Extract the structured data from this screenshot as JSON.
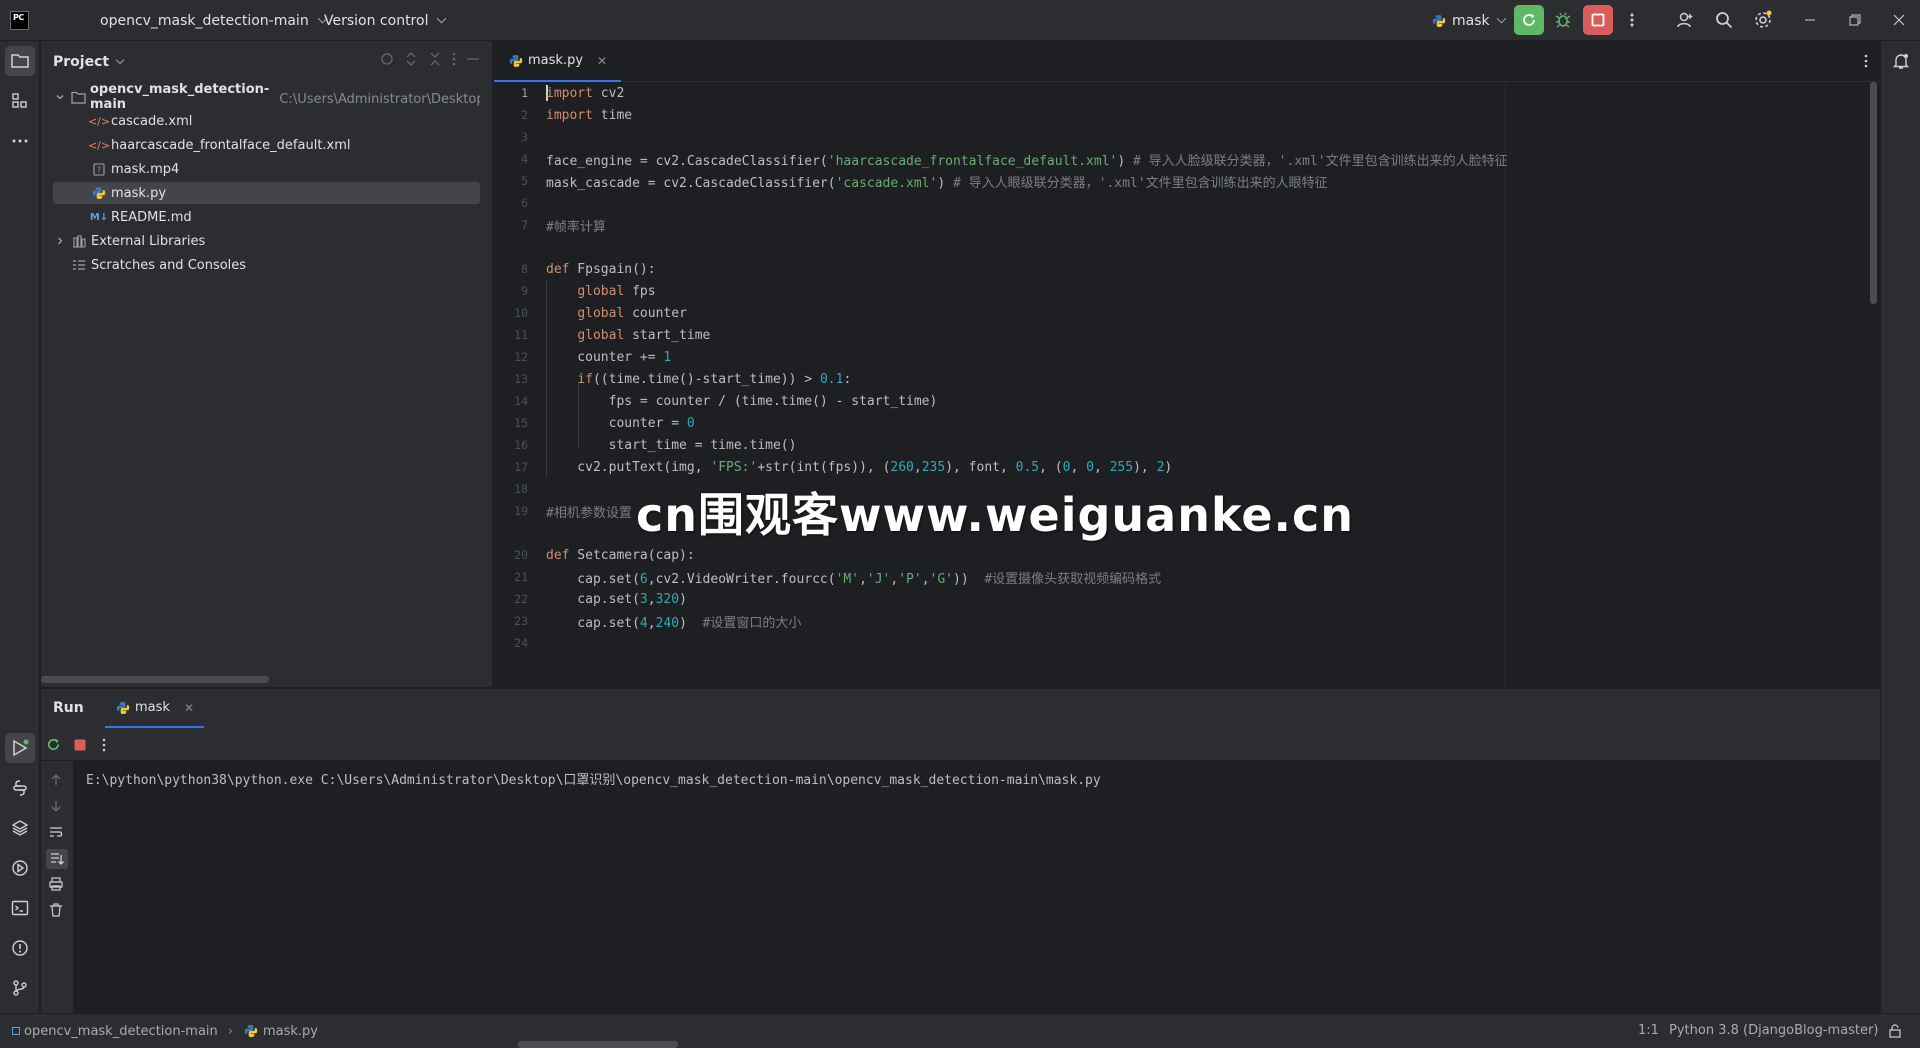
{
  "titlebar": {
    "app_logo": "PC",
    "project_name": "opencv_mask_detection-main",
    "vcs_label": "Version control",
    "run_config": "mask"
  },
  "project_panel": {
    "title": "Project",
    "root": {
      "name": "opencv_mask_detection-main",
      "path": "C:\\Users\\Administrator\\Desktop\\口罩"
    },
    "files": [
      {
        "name": "cascade.xml",
        "icon": "xml-icon"
      },
      {
        "name": "haarcascade_frontalface_default.xml",
        "icon": "xml-icon"
      },
      {
        "name": "mask.mp4",
        "icon": "unknown-file-icon"
      },
      {
        "name": "mask.py",
        "icon": "python-file-icon"
      },
      {
        "name": "README.md",
        "icon": "markdown-icon"
      }
    ],
    "external_libraries": "External Libraries",
    "scratches": "Scratches and Consoles"
  },
  "editor": {
    "tab_label": "mask.py",
    "line_numbers": [
      "1",
      "2",
      "3",
      "4",
      "5",
      "6",
      "7",
      "8",
      "9",
      "10",
      "11",
      "12",
      "13",
      "14",
      "15",
      "16",
      "17",
      "18",
      "19",
      "20",
      "21",
      "22",
      "23",
      "24"
    ]
  },
  "run_panel": {
    "title": "Run",
    "tab_label": "mask",
    "console_output": "E:\\python\\python38\\python.exe C:\\Users\\Administrator\\Desktop\\口罩识别\\opencv_mask_detection-main\\opencv_mask_detection-main\\mask.py"
  },
  "statusbar": {
    "breadcrumb_project": "opencv_mask_detection-main",
    "breadcrumb_file": "mask.py",
    "cursor_position": "1:1",
    "interpreter": "Python 3.8 (DjangoBlog-master)"
  },
  "watermark": "cn围观客www.weiguanke.cn",
  "colors": {
    "accent": "#3574f0",
    "run_green": "#5fb865",
    "stop_red": "#db5c5c",
    "keyword": "#cf8e6d",
    "string": "#6aab73",
    "number": "#2aacb8",
    "comment": "#7a7e85"
  }
}
